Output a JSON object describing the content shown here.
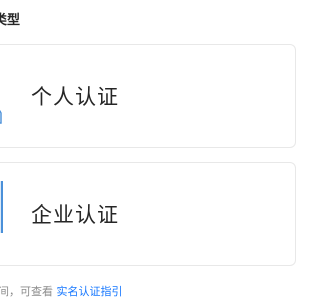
{
  "section": {
    "title": "类型"
  },
  "options": {
    "personal": {
      "label": "个人认证",
      "icon": "person-icon"
    },
    "enterprise": {
      "label": "企业认证",
      "icon": "building-icon"
    }
  },
  "footer": {
    "prefix": "间，可查看",
    "link_text": "实名认证指引"
  },
  "colors": {
    "link": "#1677ff",
    "icon_accent": "#4a90d9",
    "border": "#e8e8e8"
  }
}
